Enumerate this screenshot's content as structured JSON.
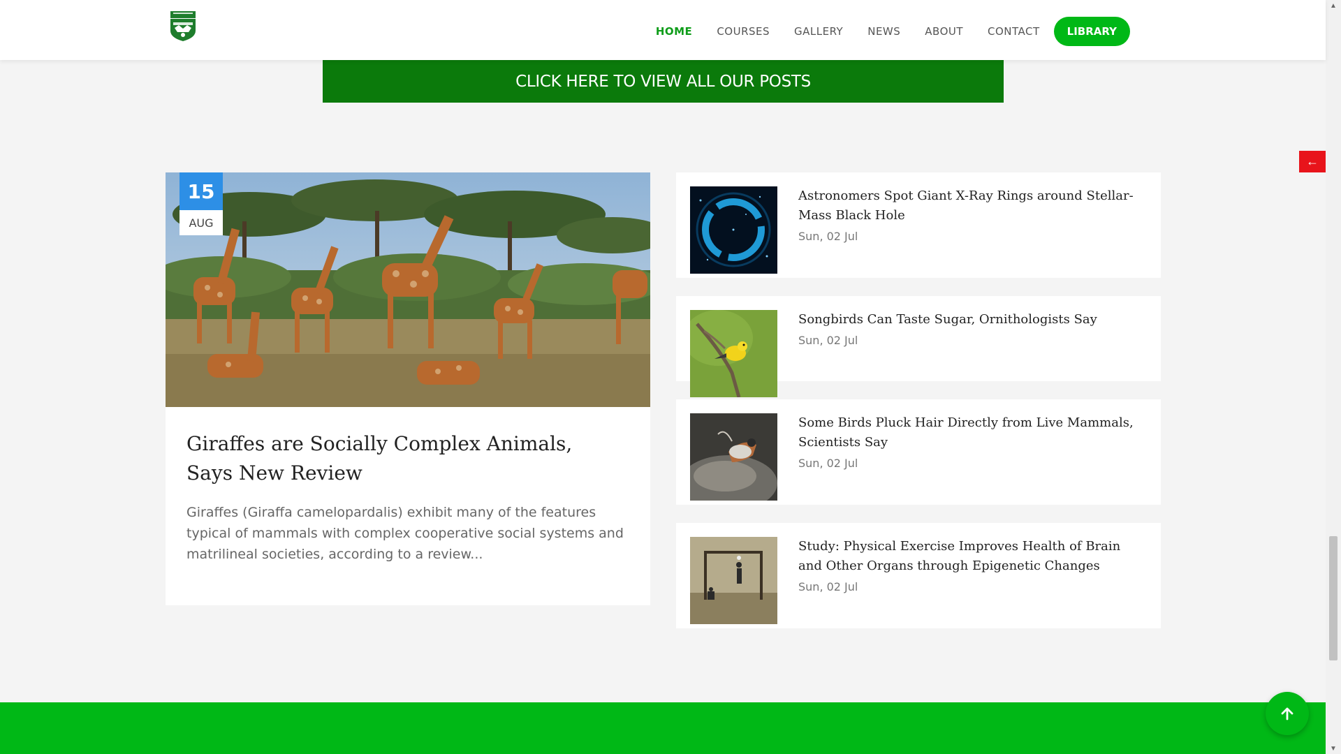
{
  "header": {
    "nav": [
      {
        "label": "HOME",
        "active": true
      },
      {
        "label": "COURSES",
        "active": false
      },
      {
        "label": "GALLERY",
        "active": false
      },
      {
        "label": "NEWS",
        "active": false
      },
      {
        "label": "ABOUT",
        "active": false
      },
      {
        "label": "CONTACT",
        "active": false
      }
    ],
    "library_label": "LIBRARY",
    "logo_icon": "school-crest-icon"
  },
  "banner": {
    "view_all_label": "CLICK HERE TO VIEW ALL OUR POSTS"
  },
  "featured": {
    "day": "15",
    "month": "AUG",
    "title": "Giraffes are Socially Complex Animals, Says New Review",
    "excerpt": "Giraffes (Giraffa camelopardalis) exhibit many of the features typical of mammals with complex cooperative social systems and matrilineal societies, according to a review...",
    "image": "giraffes-savanna-photo"
  },
  "posts": [
    {
      "title": "Astronomers Spot Giant X-Ray Rings around Stellar-Mass Black Hole",
      "date": "Sun, 02 Jul",
      "image": "xray-rings-photo"
    },
    {
      "title": "Songbirds Can Taste Sugar, Ornithologists Say",
      "date": "Sun, 02 Jul",
      "image": "yellow-songbird-photo"
    },
    {
      "title": "Some Birds Pluck Hair Directly from Live Mammals, Scientists Say",
      "date": "Sun, 02 Jul",
      "image": "bird-plucking-hair-photo"
    },
    {
      "title": "Study: Physical Exercise Improves Health of Brain and Other Organs through Epigenetic Changes",
      "date": "Sun, 02 Jul",
      "image": "kids-playing-football-photo"
    }
  ],
  "colors": {
    "primary_green": "#00b816",
    "dark_green": "#0b7a0b",
    "date_blue": "#2d8fe6",
    "back_tab_red": "#e8141b"
  },
  "icons": {
    "back_tab": "arrow-left-icon",
    "scroll_top": "arrow-up-icon"
  }
}
